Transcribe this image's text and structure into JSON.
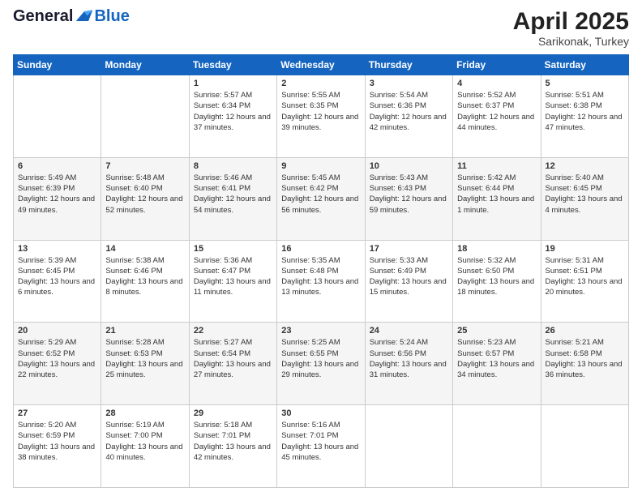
{
  "header": {
    "logo_general": "General",
    "logo_blue": "Blue",
    "month_title": "April 2025",
    "subtitle": "Sarikonak, Turkey"
  },
  "days_of_week": [
    "Sunday",
    "Monday",
    "Tuesday",
    "Wednesday",
    "Thursday",
    "Friday",
    "Saturday"
  ],
  "weeks": [
    [
      {
        "day": "",
        "sunrise": "",
        "sunset": "",
        "daylight": ""
      },
      {
        "day": "",
        "sunrise": "",
        "sunset": "",
        "daylight": ""
      },
      {
        "day": "1",
        "sunrise": "Sunrise: 5:57 AM",
        "sunset": "Sunset: 6:34 PM",
        "daylight": "Daylight: 12 hours and 37 minutes."
      },
      {
        "day": "2",
        "sunrise": "Sunrise: 5:55 AM",
        "sunset": "Sunset: 6:35 PM",
        "daylight": "Daylight: 12 hours and 39 minutes."
      },
      {
        "day": "3",
        "sunrise": "Sunrise: 5:54 AM",
        "sunset": "Sunset: 6:36 PM",
        "daylight": "Daylight: 12 hours and 42 minutes."
      },
      {
        "day": "4",
        "sunrise": "Sunrise: 5:52 AM",
        "sunset": "Sunset: 6:37 PM",
        "daylight": "Daylight: 12 hours and 44 minutes."
      },
      {
        "day": "5",
        "sunrise": "Sunrise: 5:51 AM",
        "sunset": "Sunset: 6:38 PM",
        "daylight": "Daylight: 12 hours and 47 minutes."
      }
    ],
    [
      {
        "day": "6",
        "sunrise": "Sunrise: 5:49 AM",
        "sunset": "Sunset: 6:39 PM",
        "daylight": "Daylight: 12 hours and 49 minutes."
      },
      {
        "day": "7",
        "sunrise": "Sunrise: 5:48 AM",
        "sunset": "Sunset: 6:40 PM",
        "daylight": "Daylight: 12 hours and 52 minutes."
      },
      {
        "day": "8",
        "sunrise": "Sunrise: 5:46 AM",
        "sunset": "Sunset: 6:41 PM",
        "daylight": "Daylight: 12 hours and 54 minutes."
      },
      {
        "day": "9",
        "sunrise": "Sunrise: 5:45 AM",
        "sunset": "Sunset: 6:42 PM",
        "daylight": "Daylight: 12 hours and 56 minutes."
      },
      {
        "day": "10",
        "sunrise": "Sunrise: 5:43 AM",
        "sunset": "Sunset: 6:43 PM",
        "daylight": "Daylight: 12 hours and 59 minutes."
      },
      {
        "day": "11",
        "sunrise": "Sunrise: 5:42 AM",
        "sunset": "Sunset: 6:44 PM",
        "daylight": "Daylight: 13 hours and 1 minute."
      },
      {
        "day": "12",
        "sunrise": "Sunrise: 5:40 AM",
        "sunset": "Sunset: 6:45 PM",
        "daylight": "Daylight: 13 hours and 4 minutes."
      }
    ],
    [
      {
        "day": "13",
        "sunrise": "Sunrise: 5:39 AM",
        "sunset": "Sunset: 6:45 PM",
        "daylight": "Daylight: 13 hours and 6 minutes."
      },
      {
        "day": "14",
        "sunrise": "Sunrise: 5:38 AM",
        "sunset": "Sunset: 6:46 PM",
        "daylight": "Daylight: 13 hours and 8 minutes."
      },
      {
        "day": "15",
        "sunrise": "Sunrise: 5:36 AM",
        "sunset": "Sunset: 6:47 PM",
        "daylight": "Daylight: 13 hours and 11 minutes."
      },
      {
        "day": "16",
        "sunrise": "Sunrise: 5:35 AM",
        "sunset": "Sunset: 6:48 PM",
        "daylight": "Daylight: 13 hours and 13 minutes."
      },
      {
        "day": "17",
        "sunrise": "Sunrise: 5:33 AM",
        "sunset": "Sunset: 6:49 PM",
        "daylight": "Daylight: 13 hours and 15 minutes."
      },
      {
        "day": "18",
        "sunrise": "Sunrise: 5:32 AM",
        "sunset": "Sunset: 6:50 PM",
        "daylight": "Daylight: 13 hours and 18 minutes."
      },
      {
        "day": "19",
        "sunrise": "Sunrise: 5:31 AM",
        "sunset": "Sunset: 6:51 PM",
        "daylight": "Daylight: 13 hours and 20 minutes."
      }
    ],
    [
      {
        "day": "20",
        "sunrise": "Sunrise: 5:29 AM",
        "sunset": "Sunset: 6:52 PM",
        "daylight": "Daylight: 13 hours and 22 minutes."
      },
      {
        "day": "21",
        "sunrise": "Sunrise: 5:28 AM",
        "sunset": "Sunset: 6:53 PM",
        "daylight": "Daylight: 13 hours and 25 minutes."
      },
      {
        "day": "22",
        "sunrise": "Sunrise: 5:27 AM",
        "sunset": "Sunset: 6:54 PM",
        "daylight": "Daylight: 13 hours and 27 minutes."
      },
      {
        "day": "23",
        "sunrise": "Sunrise: 5:25 AM",
        "sunset": "Sunset: 6:55 PM",
        "daylight": "Daylight: 13 hours and 29 minutes."
      },
      {
        "day": "24",
        "sunrise": "Sunrise: 5:24 AM",
        "sunset": "Sunset: 6:56 PM",
        "daylight": "Daylight: 13 hours and 31 minutes."
      },
      {
        "day": "25",
        "sunrise": "Sunrise: 5:23 AM",
        "sunset": "Sunset: 6:57 PM",
        "daylight": "Daylight: 13 hours and 34 minutes."
      },
      {
        "day": "26",
        "sunrise": "Sunrise: 5:21 AM",
        "sunset": "Sunset: 6:58 PM",
        "daylight": "Daylight: 13 hours and 36 minutes."
      }
    ],
    [
      {
        "day": "27",
        "sunrise": "Sunrise: 5:20 AM",
        "sunset": "Sunset: 6:59 PM",
        "daylight": "Daylight: 13 hours and 38 minutes."
      },
      {
        "day": "28",
        "sunrise": "Sunrise: 5:19 AM",
        "sunset": "Sunset: 7:00 PM",
        "daylight": "Daylight: 13 hours and 40 minutes."
      },
      {
        "day": "29",
        "sunrise": "Sunrise: 5:18 AM",
        "sunset": "Sunset: 7:01 PM",
        "daylight": "Daylight: 13 hours and 42 minutes."
      },
      {
        "day": "30",
        "sunrise": "Sunrise: 5:16 AM",
        "sunset": "Sunset: 7:01 PM",
        "daylight": "Daylight: 13 hours and 45 minutes."
      },
      {
        "day": "",
        "sunrise": "",
        "sunset": "",
        "daylight": ""
      },
      {
        "day": "",
        "sunrise": "",
        "sunset": "",
        "daylight": ""
      },
      {
        "day": "",
        "sunrise": "",
        "sunset": "",
        "daylight": ""
      }
    ]
  ]
}
